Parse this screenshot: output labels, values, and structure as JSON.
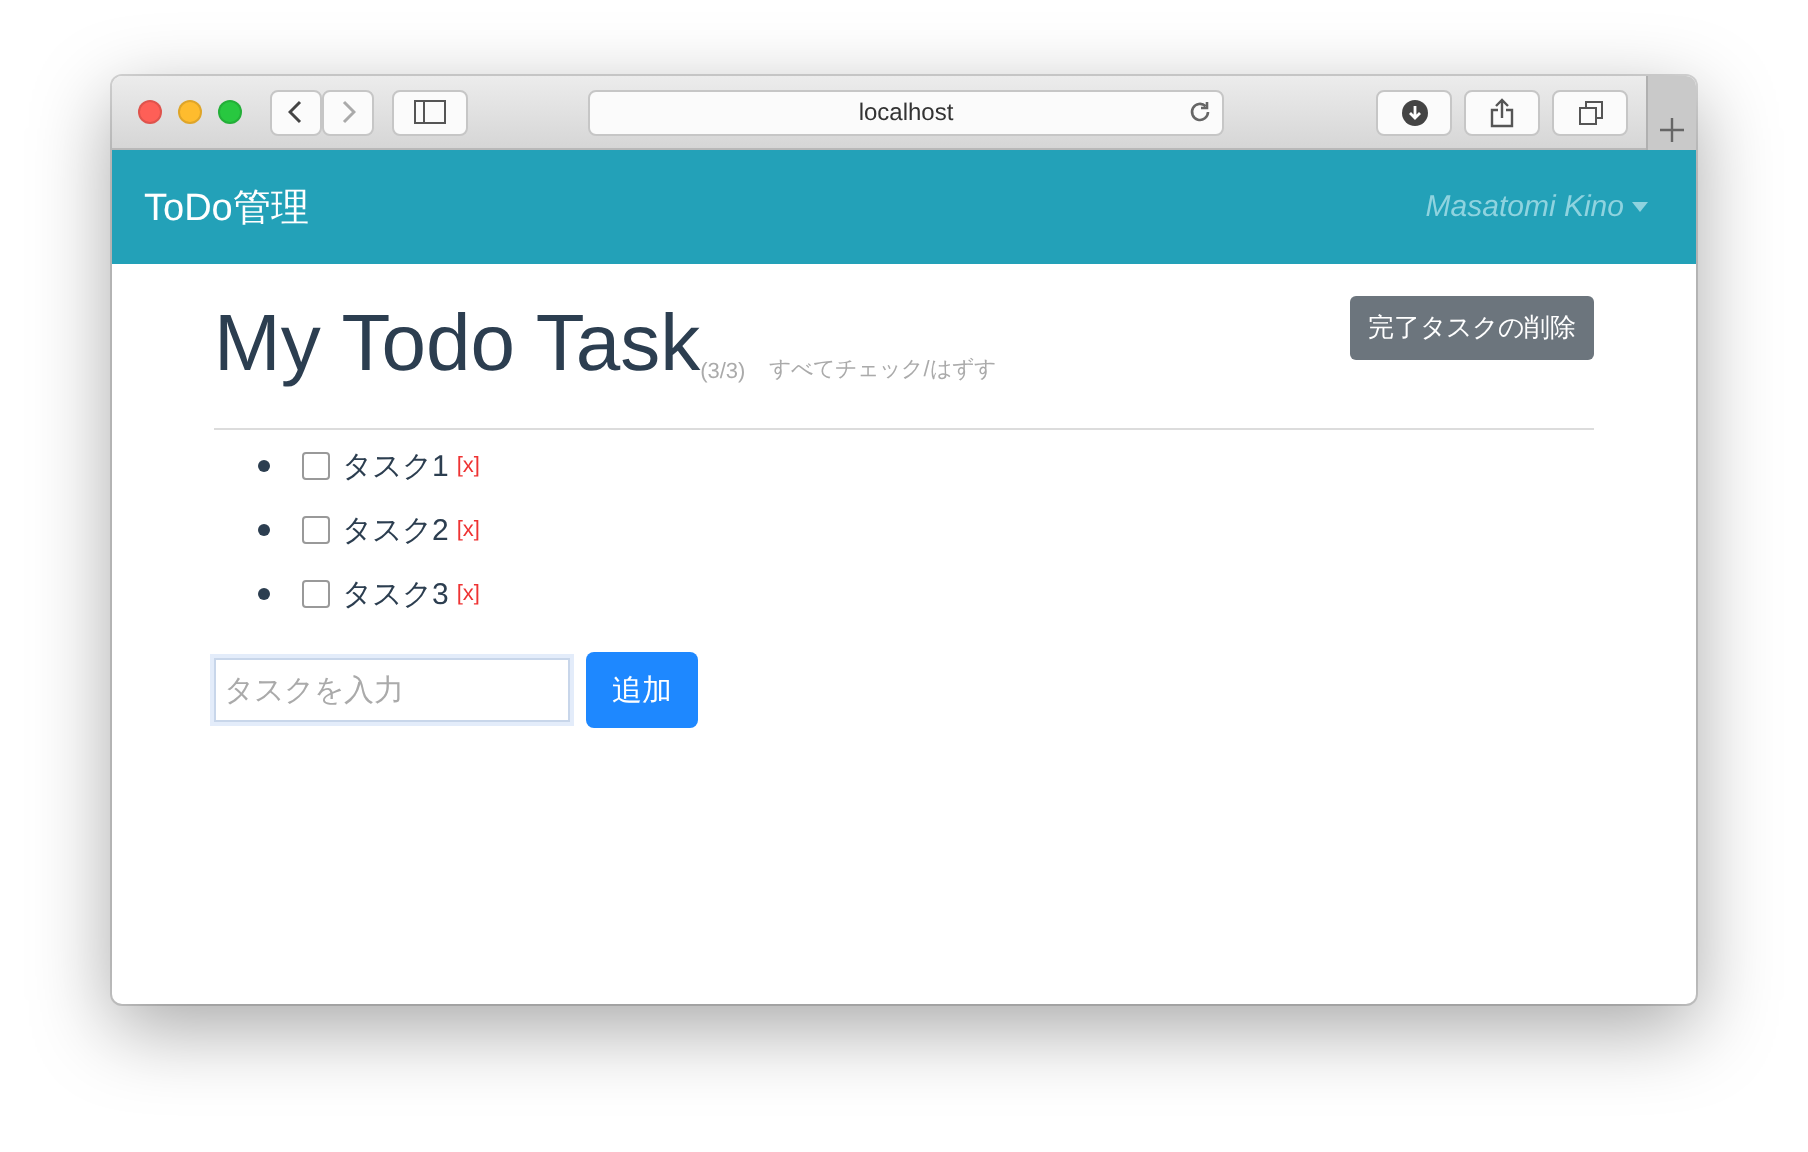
{
  "browser": {
    "address": "localhost"
  },
  "navbar": {
    "brand": "ToDo管理",
    "user": "Masatomi Kino"
  },
  "header": {
    "title": "My Todo Task",
    "count": "(3/3)",
    "toggle_all": "すべてチェック/はずす",
    "delete_done": "完了タスクの削除"
  },
  "tasks": [
    {
      "label": "タスク1",
      "checked": false,
      "remove": "[x]"
    },
    {
      "label": "タスク2",
      "checked": false,
      "remove": "[x]"
    },
    {
      "label": "タスク3",
      "checked": false,
      "remove": "[x]"
    }
  ],
  "new_task": {
    "placeholder": "タスクを入力",
    "button": "追加"
  }
}
